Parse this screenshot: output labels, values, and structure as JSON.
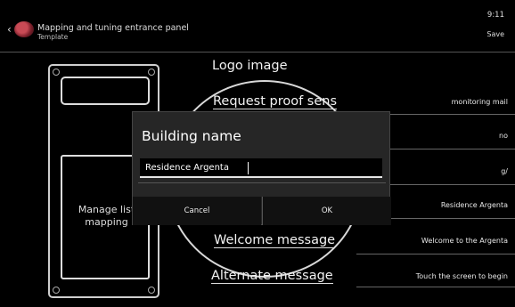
{
  "header": {
    "title": "Mapping and tuning entrance panel",
    "subtitle": "Template",
    "clock": "9:11",
    "action_label": "Save"
  },
  "phone_panel": {
    "manage_label_line1": "Manage list",
    "manage_label_line2": "mapping"
  },
  "settings": [
    {
      "label": "Logo image",
      "value": ""
    },
    {
      "label": "Request proof sens",
      "value": "monitoring mail"
    },
    {
      "label": "Building name",
      "value": "no"
    },
    {
      "label": "Welcome message",
      "value": "g/"
    },
    {
      "label": "Residence Argenta",
      "value": "Residence Argenta"
    },
    {
      "label": "Welcome message",
      "value": "Welcome to the Argenta"
    },
    {
      "label": "Alternate message",
      "value": "Touch the screen to begin"
    }
  ],
  "dialog": {
    "title": "Building name",
    "input_value": "Residence Argenta",
    "cancel_label": "Cancel",
    "ok_label": "OK"
  }
}
